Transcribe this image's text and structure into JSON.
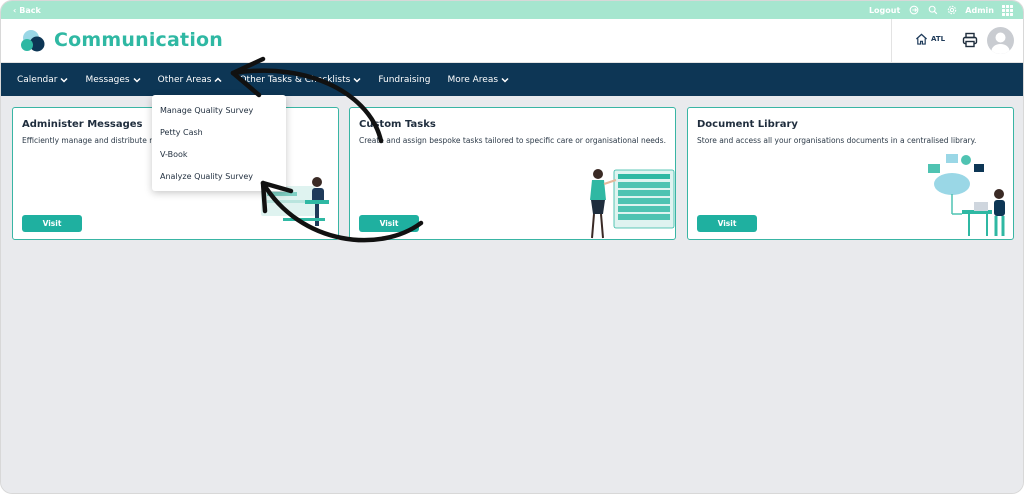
{
  "topbar": {
    "back_label": "Back",
    "logout_label": "Logout",
    "user_label": "Admin"
  },
  "header": {
    "app_title": "Communication",
    "home_code": "ATL"
  },
  "nav": {
    "items": [
      {
        "label": "Calendar",
        "has_chevron": true
      },
      {
        "label": "Messages",
        "has_chevron": true
      },
      {
        "label": "Other Areas",
        "has_chevron": true,
        "open": true
      },
      {
        "label": "Other Tasks & Checklists",
        "has_chevron": true
      },
      {
        "label": "Fundraising",
        "has_chevron": false
      },
      {
        "label": "More Areas",
        "has_chevron": true
      }
    ]
  },
  "dropdown": {
    "items": [
      "Manage Quality Survey",
      "Petty Cash",
      "V-Book",
      "Analyze Quality Survey"
    ]
  },
  "cards": [
    {
      "title": "Administer Messages",
      "description": "Efficiently manage and distribute messages across your organisation.",
      "button": "Visit"
    },
    {
      "title": "Custom Tasks",
      "description": "Create and assign bespoke tasks tailored to specific care or organisational needs.",
      "button": "Visit"
    },
    {
      "title": "Document Library",
      "description": "Store and access all your organisations documents in a centralised library.",
      "button": "Visit"
    }
  ],
  "colors": {
    "topbar": "#a6e6cf",
    "nav": "#0d3655",
    "accent": "#1fb0a0",
    "title": "#2fb8a3"
  },
  "icons": [
    "chevron-left-icon",
    "logout-icon",
    "search-icon",
    "gear-icon",
    "apps-grid-icon",
    "home-icon",
    "printer-icon",
    "user-avatar-icon",
    "chevron-down-icon",
    "chevron-up-icon"
  ]
}
